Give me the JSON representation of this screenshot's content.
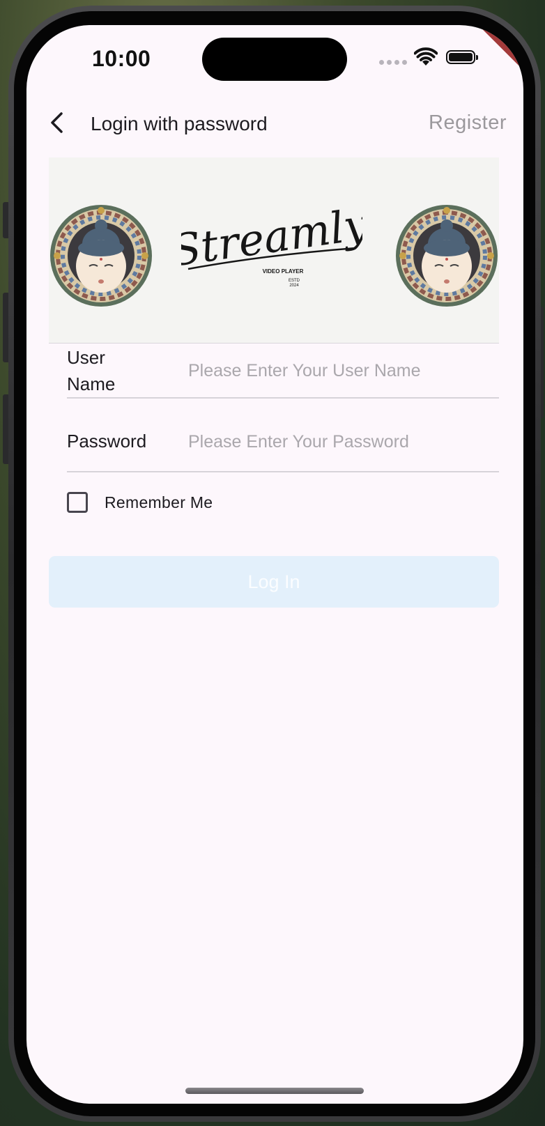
{
  "status_bar": {
    "time": "10:00"
  },
  "debug_banner": "DEBUG",
  "app_bar": {
    "title": "Login with password",
    "register_label": "Register"
  },
  "banner": {
    "logo_alt": "Streamly",
    "logo_sub1": "VIDEO PLAYER",
    "logo_sub2": "ESTD",
    "logo_sub3": "2024"
  },
  "form": {
    "username_label": "User Name",
    "username_placeholder": "Please Enter Your User Name",
    "username_value": "",
    "password_label": "Password",
    "password_placeholder": "Please Enter Your Password",
    "password_value": "",
    "remember_label": "Remember Me",
    "remember_checked": false
  },
  "login_button_label": "Log In",
  "colors": {
    "screen_bg": "#fdf7fc",
    "login_button_bg": "#e3f0fb",
    "debug_banner": "#a33a3a",
    "register_text": "#9b989c"
  }
}
